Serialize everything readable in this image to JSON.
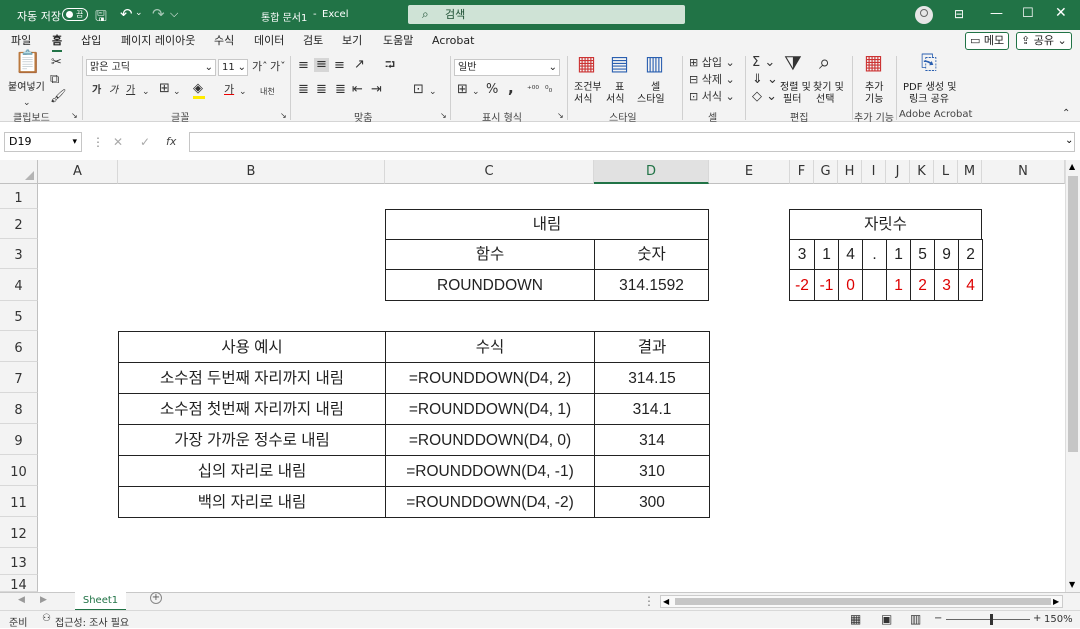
{
  "titlebar": {
    "autosave_label": "자동 저장",
    "autosave_state": "끔",
    "doc_title": "통합 문서1",
    "app_separator": "-",
    "app_name": "Excel",
    "search_placeholder": "검색"
  },
  "menu": {
    "tabs": [
      "파일",
      "홈",
      "삽입",
      "페이지 레이아웃",
      "수식",
      "데이터",
      "검토",
      "보기",
      "도움말",
      "Acrobat"
    ],
    "selected": "홈",
    "memo_label": "메모",
    "share_label": "공유"
  },
  "ribbon": {
    "clipboard": {
      "paste": "붙여넣기",
      "group": "클립보드"
    },
    "font": {
      "name": "맑은 고딕",
      "size": "11",
      "group": "글꼴",
      "bold": "가",
      "italic": "가",
      "underline": "가",
      "font_color_glyph": "가",
      "ruby": "내천"
    },
    "align": {
      "group": "맞춤"
    },
    "number": {
      "format": "일반",
      "group": "표시 형식",
      "percent": "%",
      "comma": ","
    },
    "styles": {
      "cond1": "조건부",
      "cond2": "서식",
      "table1": "표",
      "table2": "서식",
      "cell1": "셀",
      "cell2": "스타일",
      "group": "스타일"
    },
    "cells": {
      "insert": "삽입",
      "delete": "삭제",
      "format": "서식",
      "group": "셀"
    },
    "edit": {
      "sort1": "정렬 및",
      "sort2": "필터",
      "find1": "찾기 및",
      "find2": "선택",
      "group": "편집"
    },
    "addins": {
      "l1": "추가",
      "l2": "기능",
      "group": "추가 기능"
    },
    "acrobat": {
      "l1": "PDF 생성 및",
      "l2": "링크 공유",
      "group": "Adobe Acrobat"
    }
  },
  "formula_bar": {
    "name_box": "D19",
    "fx": "fx",
    "value": ""
  },
  "columns": [
    "A",
    "B",
    "C",
    "D",
    "E",
    "F",
    "G",
    "H",
    "I",
    "J",
    "K",
    "L",
    "M",
    "N"
  ],
  "selected_column": "D",
  "rows": [
    "1",
    "2",
    "3",
    "4",
    "5",
    "6",
    "7",
    "8",
    "9",
    "10",
    "11",
    "12",
    "13",
    "14"
  ],
  "table_round": {
    "title": "내림",
    "h1": "함수",
    "h2": "숫자",
    "func": "ROUNDDOWN",
    "number": "314.1592"
  },
  "table_digits": {
    "title": "자릿수",
    "digits": [
      "3",
      "1",
      "4",
      ".",
      "1",
      "5",
      "9",
      "2"
    ],
    "positions": [
      "-2",
      "-1",
      "0",
      "",
      "1",
      "2",
      "3",
      "4"
    ]
  },
  "table_examples": {
    "headers": [
      "사용 예시",
      "수식",
      "결과"
    ],
    "rows": [
      [
        "소수점 두번째 자리까지 내림",
        "=ROUNDDOWN(D4, 2)",
        "314.15"
      ],
      [
        "소수점 첫번째 자리까지 내림",
        "=ROUNDDOWN(D4, 1)",
        "314.1"
      ],
      [
        "가장 가까운 정수로 내림",
        "=ROUNDDOWN(D4, 0)",
        "314"
      ],
      [
        "십의 자리로 내림",
        "=ROUNDDOWN(D4, -1)",
        "310"
      ],
      [
        "백의 자리로 내림",
        "=ROUNDDOWN(D4, -2)",
        "300"
      ]
    ]
  },
  "sheets": {
    "tab": "Sheet1",
    "add": "+"
  },
  "status": {
    "ready": "준비",
    "accessibility": "접근성: 조사 필요",
    "zoom": "150%"
  },
  "colors": {
    "brand": "#217346",
    "red_text": "#d00000"
  }
}
